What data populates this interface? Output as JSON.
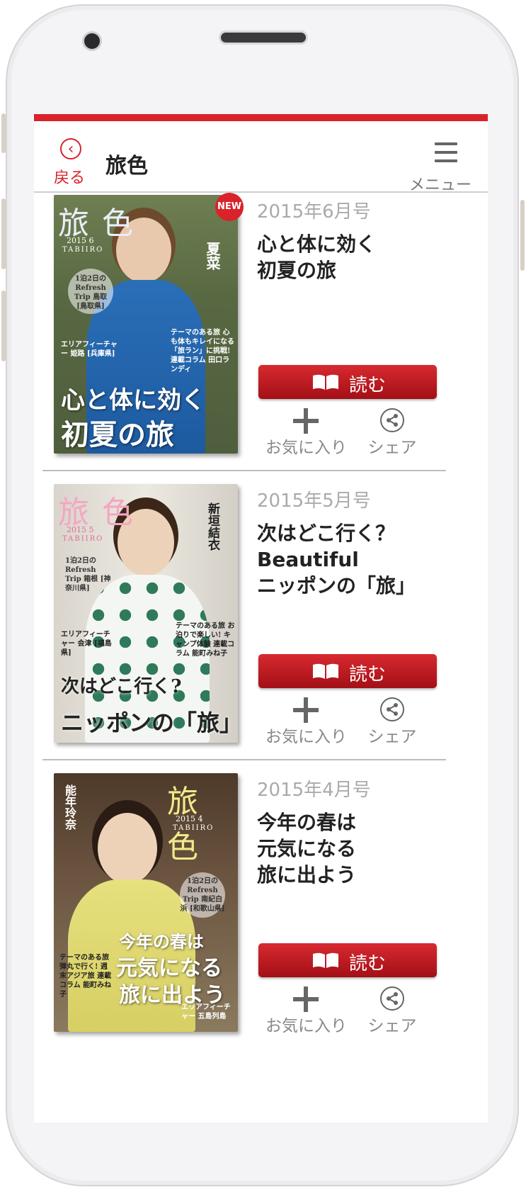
{
  "header": {
    "back_icon": "‹",
    "back_label": "戻る",
    "title": "旅色",
    "menu_label": "メニュー"
  },
  "colors": {
    "brand_red": "#d9222a",
    "read_button": "#b8141b",
    "date_gray": "#aaaaaa"
  },
  "issues": [
    {
      "date": "2015年6月号",
      "title_line1": "心と体に効く",
      "title_line2": "初夏の旅",
      "title_line3": "",
      "badge": "NEW",
      "read_label": "読む",
      "favorite_label": "お気に入り",
      "share_label": "シェア",
      "cover": {
        "logo": "旅 色",
        "year": "2015 6",
        "tabiiro": "TABIIRO",
        "headline1": "心と体に効く",
        "headline2": "初夏の旅",
        "vertical": "夏菜",
        "trip": "1泊2日の Refresh Trip 鳥取 [鳥取県]",
        "feature": "エリアフィーチャー 姫路 [兵庫県]",
        "topics": "テーマのある旅 心も体もキレイになる 「旅ラン」に挑戦! 連載コラム 田口ランディ"
      }
    },
    {
      "date": "2015年5月号",
      "title_line1": "次はどこ行く？",
      "title_line2": "Beautiful",
      "title_line3": "ニッポンの「旅」",
      "badge": "",
      "read_label": "読む",
      "favorite_label": "お気に入り",
      "share_label": "シェア",
      "cover": {
        "logo": "旅 色",
        "year": "2015 5",
        "tabiiro": "TABIIRO",
        "headline1": "次はどこ行く?",
        "headline2": "ニッポンの「旅」",
        "vertical": "新垣結衣",
        "trip": "1泊2日の Refresh Trip 箱根 [神奈川県]",
        "feature": "エリアフィーチャー 会津 [福島県]",
        "topics": "テーマのある旅 お泊りで楽しい! キャンプ体験 連載コラム 能町みね子"
      }
    },
    {
      "date": "2015年4月号",
      "title_line1": "今年の春は",
      "title_line2": "元気になる",
      "title_line3": "旅に出よう",
      "badge": "",
      "read_label": "読む",
      "favorite_label": "お気に入り",
      "share_label": "シェア",
      "cover": {
        "logo": "旅 色",
        "year": "2015 4",
        "tabiiro": "TABIIRO",
        "headline1": "今年の春は",
        "headline2": "元気になる",
        "headline3": "旅に出よう",
        "vertical": "能年玲奈",
        "trip": "1泊2日の Refresh Trip 南紀白浜 [和歌山県]",
        "feature": "エリアフィーチャー 五島列島",
        "topics": "テーマのある旅 弾丸で行く! 週末アジア旅 連載コラム 能町みね子"
      }
    }
  ]
}
